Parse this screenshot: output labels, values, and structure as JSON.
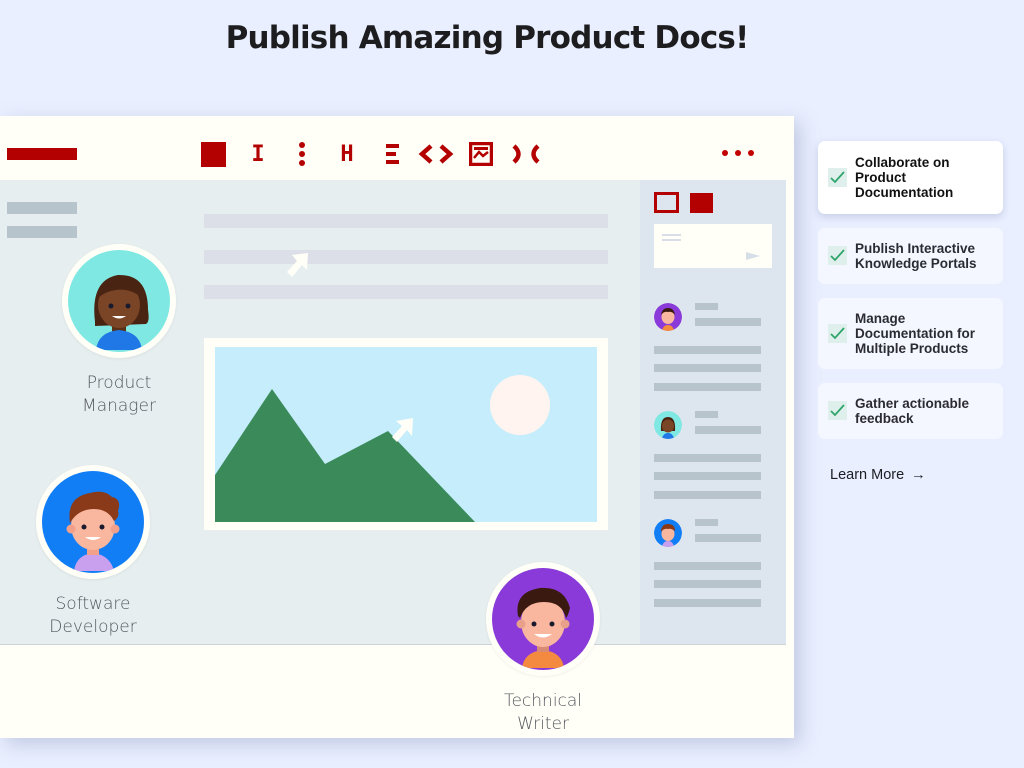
{
  "header": {
    "title": "Publish Amazing Product Docs!"
  },
  "editor": {
    "toolbar": {
      "icons": [
        {
          "name": "block-icon",
          "glyph": ""
        },
        {
          "name": "text-cursor-icon",
          "glyph": "I"
        },
        {
          "name": "vertical-dots-icon",
          "glyph": "⋮"
        },
        {
          "name": "heading-icon",
          "glyph": "H"
        },
        {
          "name": "list-icon",
          "glyph": "☰"
        },
        {
          "name": "code-icon",
          "glyph": "<>"
        },
        {
          "name": "image-icon",
          "glyph": ""
        },
        {
          "name": "embed-icon",
          "glyph": ")("
        }
      ],
      "more_icon": "more-horizontal-icon"
    },
    "roles": {
      "product_manager": {
        "line1": "Product",
        "line2": "Manager"
      },
      "software_developer": {
        "line1": "Software",
        "line2": "Developer"
      },
      "technical_writer": {
        "line1": "Technical",
        "line2": "Writer"
      }
    }
  },
  "features": [
    {
      "label": "Collaborate on Product Documentation",
      "active": true
    },
    {
      "label": "Publish Interactive Knowledge Portals",
      "active": false
    },
    {
      "label": "Manage Documentation for Multiple Products",
      "active": false
    },
    {
      "label": "Gather actionable feedback",
      "active": false
    }
  ],
  "learn_more": {
    "label": "Learn More",
    "icon": "→"
  },
  "colors": {
    "accent": "#b30000",
    "background": "#e9efff",
    "check": "#2fa46b",
    "mountain": "#3a8a5a",
    "sky": "#c5edfc"
  }
}
